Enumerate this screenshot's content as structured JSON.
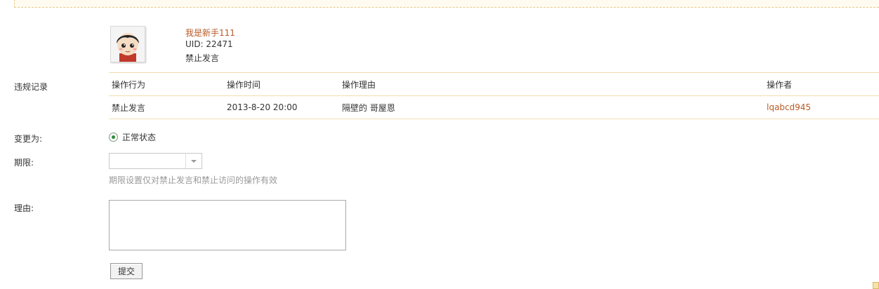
{
  "user": {
    "name": "我是新手111",
    "uid": "UID: 22471",
    "status": "禁止发言"
  },
  "violations": {
    "label": "违规记录",
    "columns": [
      "操作行为",
      "操作时间",
      "操作理由",
      "操作者"
    ],
    "rows": [
      {
        "action": "禁止发言",
        "time": "2013-8-20 20:00",
        "reason": "隔壁的 哥屋恩",
        "operator": "lqabcd945"
      }
    ]
  },
  "change": {
    "label": "变更为:",
    "option_label": "正常状态"
  },
  "period": {
    "label": "期限:",
    "value": "",
    "hint": "期限设置仅对禁止发言和禁止访问的操作有效"
  },
  "reason": {
    "label": "理由:",
    "value": ""
  },
  "submit_label": "提交",
  "colors": {
    "accent": "#b85b26",
    "table_border": "#f2dcae",
    "radio_selected": "#2e8b3a"
  }
}
